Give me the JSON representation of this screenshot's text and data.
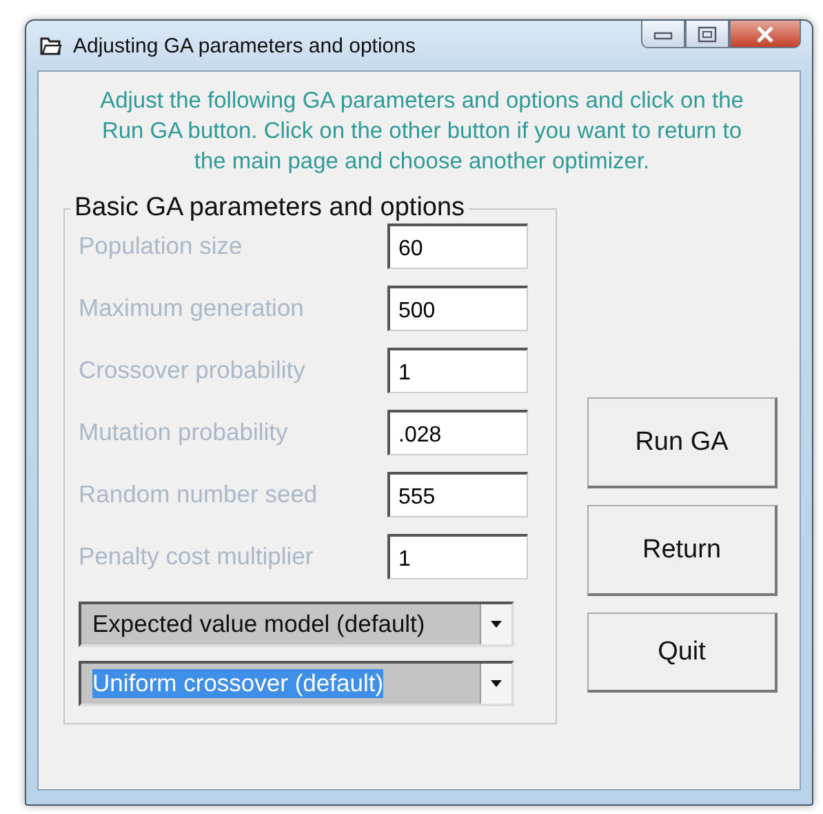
{
  "window": {
    "title": "Adjusting GA parameters and options"
  },
  "instructions": "Adjust the following GA parameters and options and click on the Run GA button. Click on the other button if you want to return to the main page and choose another optimizer.",
  "group": {
    "title": "Basic GA parameters and options",
    "parameters": [
      {
        "label": "Population size",
        "value": "60",
        "disabled": true
      },
      {
        "label": "Maximum generation",
        "value": "500",
        "disabled": true
      },
      {
        "label": "Crossover probability",
        "value": "1",
        "disabled": true
      },
      {
        "label": "Mutation probability",
        "value": ".028",
        "disabled": true
      },
      {
        "label": "Random number seed",
        "value": "555",
        "disabled": true
      },
      {
        "label": "Penalty cost multiplier",
        "value": "1",
        "disabled": true
      }
    ],
    "dropdowns": [
      {
        "value": "Expected value model (default)",
        "selected": false
      },
      {
        "value": "Uniform crossover (default)",
        "selected": true
      }
    ]
  },
  "buttons": [
    "Run GA",
    "Return",
    "Quit"
  ]
}
